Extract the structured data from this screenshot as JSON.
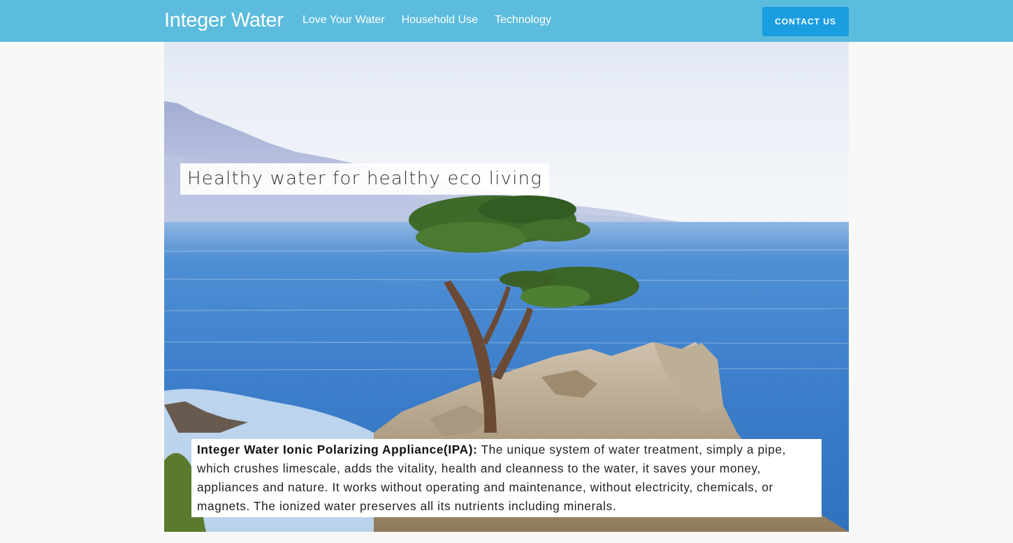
{
  "colors": {
    "header_bg": "#5bbcdd",
    "contact_button": "#1a9ee0"
  },
  "header": {
    "brand": "Integer Water",
    "nav": [
      {
        "label": "Love Your Water"
      },
      {
        "label": "Household Use"
      },
      {
        "label": "Technology"
      }
    ],
    "contact_label": "CONTACT US"
  },
  "hero": {
    "image_description": "coastal photo: lone cypress tree on rocky outcrop above blue ocean",
    "tagline": "Healthy water for healthy eco living",
    "description_title": "Integer Water Ionic Polarizing Appliance(IPA):",
    "description_text": " The unique system of water treatment, simply a pipe, which crushes limescale, adds the vitality, health and cleanness to the water, it saves your money, appliances and nature. It works without operating and maintenance, without electricity, chemicals, or magnets. The ionized water preserves all its nutrients including minerals."
  }
}
